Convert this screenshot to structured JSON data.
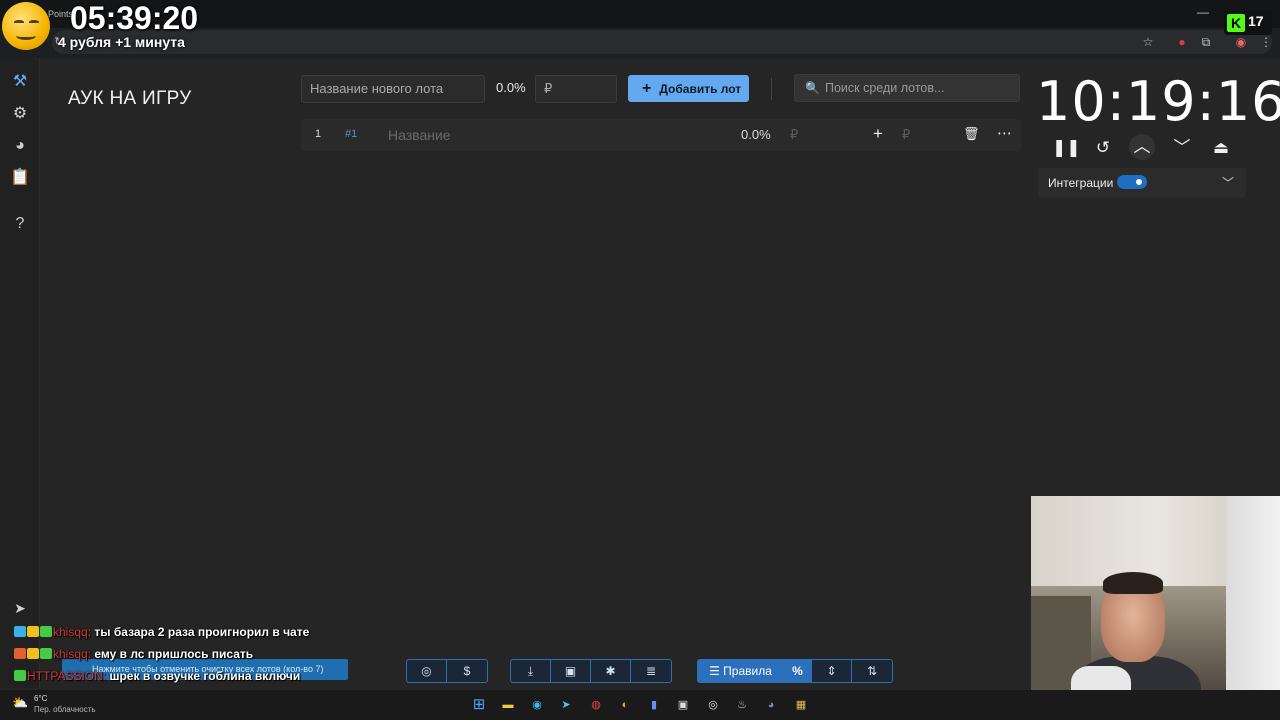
{
  "overlay": {
    "points_label": "Points",
    "stream_clock": "05:39:20",
    "stream_rate": "4 рубля +1 минута",
    "kick_count": "17",
    "chat": [
      {
        "nick": "khisqq:",
        "text": "ты базара 2 раза проигнорил в чате"
      },
      {
        "nick": "khisqq:",
        "text": "ему в лс пришлось писать"
      },
      {
        "nick": "HTTPASSION:",
        "text": "шрек в озвучке гоблина включи"
      }
    ],
    "snackbar": "Нажмите чтобы отменить очистку всех лотов (кол-во 7)"
  },
  "app": {
    "title": "АУК НА ИГРУ",
    "new_lot_placeholder": "Название нового лота",
    "new_lot_percent": "0.0%",
    "amount_placeholder": "₽",
    "add_lot_label": "Добавить лот",
    "search_placeholder": "Поиск среди лотов..."
  },
  "lots": [
    {
      "index": "1",
      "tag": "#1",
      "name_placeholder": "Название",
      "percent": "0.0%",
      "currency": "₽",
      "plus": "+",
      "amount_currency": "₽"
    }
  ],
  "timer": {
    "display": "10:19:16",
    "integrations_label": "Интеграции",
    "integrations_on": true
  },
  "toolbar": {
    "rules_label": "Правила",
    "percent_label": "%"
  },
  "taskbar": {
    "temperature": "6°C",
    "weather": "Пер. облачность"
  },
  "colors": {
    "accent": "#64a9f0",
    "toolbar_blue": "#2b6fbd",
    "toggle": "#1e6fbf",
    "background": "#252525"
  }
}
